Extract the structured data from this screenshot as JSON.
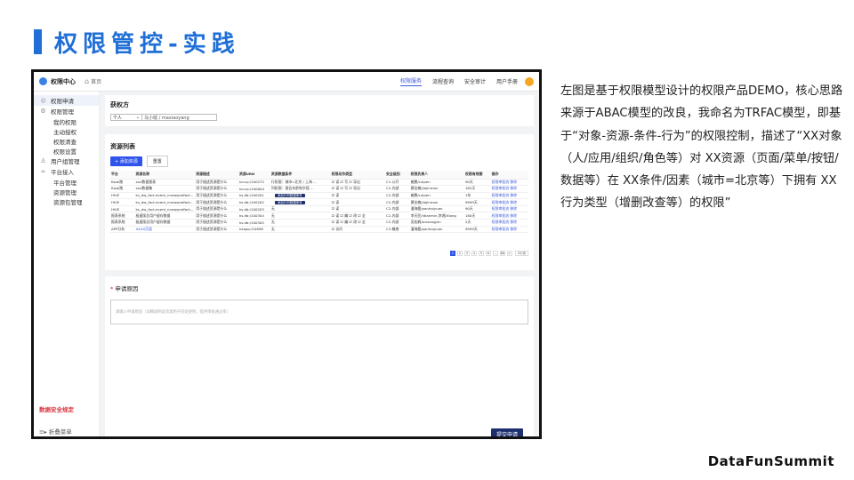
{
  "slide": {
    "title": "权限管控-实践",
    "description": "左图是基于权限模型设计的权限产品DEMO，核心思路来源于ABAC模型的改良，我命名为TRFAC模型，即基于“对象-资源-条件-行为”的权限控制，描述了“XX对象（人/应用/组织/角色等）对 XX资源（页面/菜单/按钮/数据等）在 XX条件/因素（城市=北京等）下拥有 XX行为类型（增删改查等）的权限”",
    "brand": "DataFunSummit",
    "accent_color": "#1f6fd6"
  },
  "app": {
    "name": "权限中心",
    "breadcrumb": "首页",
    "nav": [
      "权限服务",
      "流程查询",
      "安全审计",
      "用户手册"
    ],
    "nav_active": 0
  },
  "sidebar": {
    "items": [
      {
        "label": "权限申请",
        "icon": "check-circle-icon",
        "glyph": "◎"
      },
      {
        "label": "权限管理",
        "icon": "gear-icon",
        "glyph": "⚙"
      },
      {
        "label": "我的权限",
        "sub": true
      },
      {
        "label": "主动授权",
        "sub": true
      },
      {
        "label": "权限清查",
        "sub": true
      },
      {
        "label": "权限设置",
        "sub": true
      },
      {
        "label": "用户组管理",
        "icon": "users-icon",
        "glyph": "♙"
      },
      {
        "label": "平台接入",
        "icon": "link-icon",
        "glyph": "∞"
      },
      {
        "label": "平台管理",
        "sub": true
      },
      {
        "label": "资源管理",
        "sub": true
      },
      {
        "label": "资源包管理",
        "sub": true
      }
    ],
    "safety": "数据安全规定",
    "fold": "折叠菜单"
  },
  "applicant": {
    "title": "获权方",
    "type": "个人",
    "value": "马小瑜 / maxiaoyang"
  },
  "resources": {
    "title": "资源列表",
    "add_label": "+ 添加资源",
    "clear_label": "重置",
    "columns": [
      "平台",
      "资源名称",
      "资源描述",
      "资源URN",
      "资源数据条件",
      "权限动作类型",
      "安全级别",
      "权限负责人",
      "权限有效期",
      "操作"
    ],
    "rows": [
      [
        "Kwai跑",
        "xxx数据报表",
        "用于描述资源是什么",
        "kccrp:/100272",
        "行权限：城市=北京 / 上海 ...",
        "☑ 读 ☑ 写 ☑ 导出",
        "C1-公开",
        "崔鹏/cuipen",
        "90天",
        "权限审批流  移除"
      ],
      [
        "Kwai跑",
        "xxx数据集",
        "用于描述资源是什么",
        "kccrp:/100004",
        "列权限：报告年龄和字段 ...",
        "☑ 读 ☑ 写 ☑ 导出",
        "C2-内部",
        "黄佳楠/jiajinman",
        "182天",
        "权限审批流  移除"
      ],
      [
        "HIVE",
        "ks_dw_fact.event_nnewprotfact...",
        "用于描述资源是什么",
        "ks.db:/100201",
        "",
        "☑ 读",
        "C2-内部",
        "崔鹏/cuipen",
        "1年",
        "权限审批流  移除"
      ],
      [
        "HIVE",
        "ks_dw_fact.event_nnewprotfact...",
        "用于描述资源是什么",
        "ks.db:/100202",
        "",
        "☑ 读",
        "C2-内部",
        "黄佳楠/jiajinman",
        "9999天",
        "权限审批流  移除"
      ],
      [
        "HIVE",
        "ks_dw_fact.event_nnewprotfact...",
        "用于描述资源是什么",
        "ks.db:/100203",
        "无",
        "☑ 读",
        "C2-内部",
        "潘海鹿/panhaiyuan",
        "90天",
        "权限审批流  移除"
      ],
      [
        "报表系统",
        "极速版总用户留存数据",
        "用于描述资源是什么",
        "ks.db:/100304",
        "无",
        "☑ 读 ☑ 编 ☑ 改 ☑ 全",
        "C2-内部",
        "李天民/litianmin,李湘/Xiang",
        "180天",
        "权限审批流  移除"
      ],
      [
        "报表系统",
        "极速版总用户留存数据",
        "用于描述资源是什么",
        "ks.db:/100305",
        "无",
        "☑ 读 ☑ 编 ☑ 改 ☑ 全",
        "C2-内部",
        "吴松鹤/wusongjun",
        "2天",
        "权限审批流  移除"
      ],
      [
        "APP分析",
        "XXXX页面",
        "用于描述资源是什么",
        "kxapp:/10898",
        "无",
        "☑ 访问",
        "C3-敏感",
        "潘海鹿/panhaiyuan",
        "9999天",
        "权限审批流  移除"
      ]
    ],
    "row_badges": [
      null,
      null,
      "添加行列数据条件",
      "添加行列数据条件",
      null,
      null,
      null,
      null
    ],
    "pages": [
      "1",
      "2",
      "3",
      "4",
      "5",
      "6",
      "…",
      "88",
      ">"
    ],
    "page_size": "20/页"
  },
  "reason": {
    "label": "申请原因",
    "placeholder": "请输入申请原因（详细说明该资源用于何处使用，提供审批通过率）",
    "submit_label": "提交申请"
  }
}
